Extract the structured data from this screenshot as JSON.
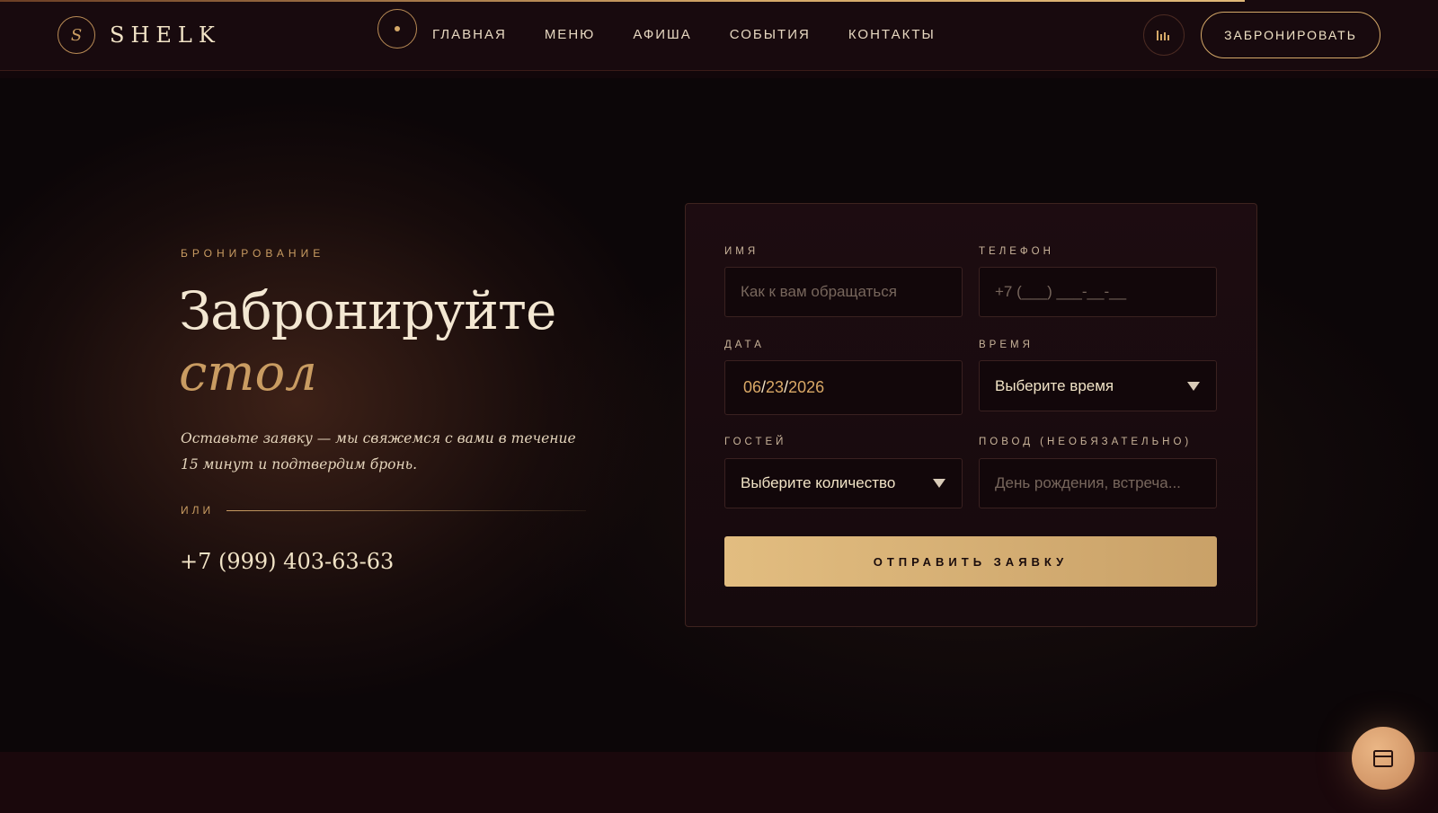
{
  "header": {
    "logo_mark": "S",
    "logo_text": "SHELK",
    "nav": [
      "ГЛАВНАЯ",
      "МЕНЮ",
      "АФИША",
      "СОБЫТИЯ",
      "КОНТАКТЫ"
    ],
    "book_label": "ЗАБРОНИРОВАТЬ"
  },
  "hero": {
    "eyebrow": "БРОНИРОВАНИЕ",
    "title": "Забронируйте",
    "title_accent": "стол",
    "lead": "Оставьте заявку — мы свяжемся с вами в течение 15 минут и подтвердим бронь.",
    "or_label": "ИЛИ",
    "phone": "+7 (999) 403-63-63"
  },
  "form": {
    "name_label": "ИМЯ",
    "name_placeholder": "Как к вам обращаться",
    "phone_label": "ТЕЛЕФОН",
    "phone_placeholder": "+7 (___) ___-__-__",
    "date_label": "ДАТА",
    "date_month": "06",
    "date_day": "23",
    "date_year": "2026",
    "date_sep": "/",
    "time_label": "ВРЕМЯ",
    "time_value": "Выберите время",
    "guests_label": "ГОСТЕЙ",
    "guests_value": "Выберите количество",
    "occasion_label": "ПОВОД (НЕОБЯЗАТЕЛЬНО)",
    "occasion_placeholder": "День рождения, встреча...",
    "submit_label": "ОТПРАВИТЬ ЗАЯВКУ"
  },
  "colors": {
    "accent": "#c99c62",
    "background": "#0c0608",
    "button": "#e2bd80"
  },
  "icons": {
    "sound": "equalizer-icon",
    "fab": "calendar-icon"
  }
}
